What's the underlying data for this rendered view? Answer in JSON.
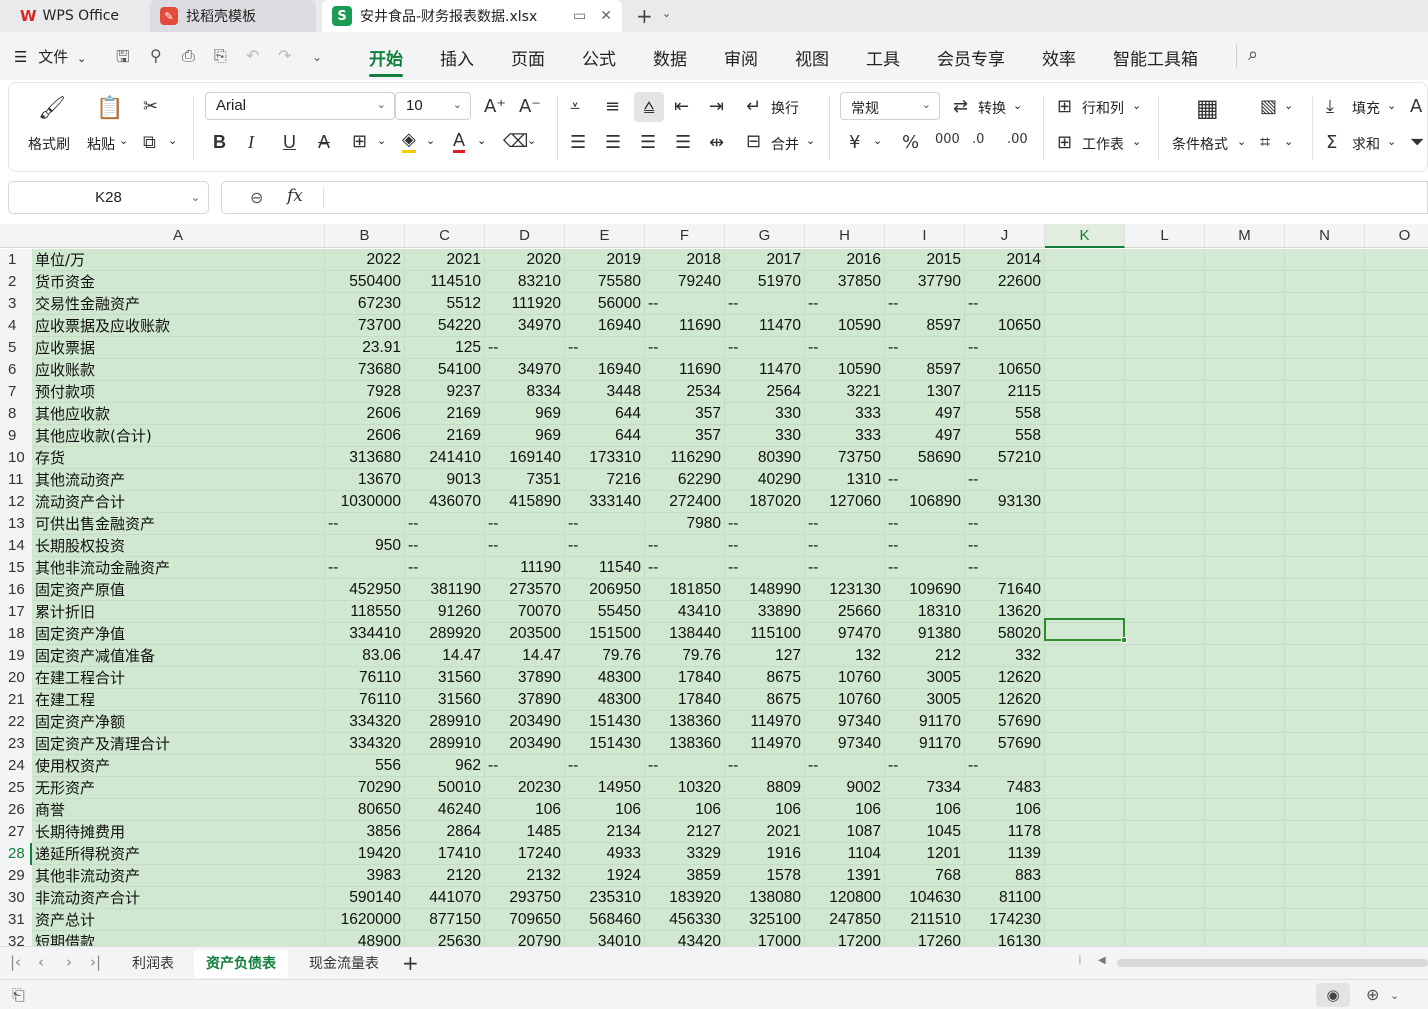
{
  "tabs": {
    "wps": "WPS Office",
    "template": "找稻壳模板",
    "file": "安井食品-财务报表数据.xlsx"
  },
  "menu": {
    "file": "文件",
    "items": [
      "开始",
      "插入",
      "页面",
      "公式",
      "数据",
      "审阅",
      "视图",
      "工具",
      "会员专享",
      "效率",
      "智能工具箱"
    ]
  },
  "ribbon": {
    "format_painter": "格式刷",
    "paste": "粘贴",
    "font": "Arial",
    "font_size": "10",
    "wrap": "换行",
    "merge": "合并",
    "number_format": "常规",
    "convert": "转换",
    "row_col": "行和列",
    "worksheet": "工作表",
    "cond_format": "条件格式",
    "fill": "填充",
    "sum": "求和"
  },
  "formula_bar": {
    "name_box": "K28",
    "fx": "fx",
    "value": ""
  },
  "columns": [
    "A",
    "B",
    "C",
    "D",
    "E",
    "F",
    "G",
    "H",
    "I",
    "J",
    "K",
    "L",
    "M",
    "N",
    "O"
  ],
  "selected_cell": "K28",
  "rows": [
    {
      "n": "1",
      "a": "单位/万",
      "v": [
        "2022",
        "2021",
        "2020",
        "2019",
        "2018",
        "2017",
        "2016",
        "2015",
        "2014"
      ]
    },
    {
      "n": "2",
      "a": "货币资金",
      "v": [
        "550400",
        "114510",
        "83210",
        "75580",
        "79240",
        "51970",
        "37850",
        "37790",
        "22600"
      ]
    },
    {
      "n": "3",
      "a": "交易性金融资产",
      "v": [
        "67230",
        "5512",
        "111920",
        "56000",
        "--",
        "--",
        "--",
        "--",
        "--"
      ]
    },
    {
      "n": "4",
      "a": "应收票据及应收账款",
      "v": [
        "73700",
        "54220",
        "34970",
        "16940",
        "11690",
        "11470",
        "10590",
        "8597",
        "10650"
      ]
    },
    {
      "n": "5",
      "a": "应收票据",
      "v": [
        "23.91",
        "125",
        "--",
        "--",
        "--",
        "--",
        "--",
        "--",
        "--"
      ]
    },
    {
      "n": "6",
      "a": "应收账款",
      "v": [
        "73680",
        "54100",
        "34970",
        "16940",
        "11690",
        "11470",
        "10590",
        "8597",
        "10650"
      ]
    },
    {
      "n": "7",
      "a": "预付款项",
      "v": [
        "7928",
        "9237",
        "8334",
        "3448",
        "2534",
        "2564",
        "3221",
        "1307",
        "2115"
      ]
    },
    {
      "n": "8",
      "a": "其他应收款",
      "v": [
        "2606",
        "2169",
        "969",
        "644",
        "357",
        "330",
        "333",
        "497",
        "558"
      ]
    },
    {
      "n": "9",
      "a": "其他应收款(合计)",
      "v": [
        "2606",
        "2169",
        "969",
        "644",
        "357",
        "330",
        "333",
        "497",
        "558"
      ]
    },
    {
      "n": "10",
      "a": "存货",
      "v": [
        "313680",
        "241410",
        "169140",
        "173310",
        "116290",
        "80390",
        "73750",
        "58690",
        "57210"
      ]
    },
    {
      "n": "11",
      "a": "其他流动资产",
      "v": [
        "13670",
        "9013",
        "7351",
        "7216",
        "62290",
        "40290",
        "1310",
        "--",
        "--"
      ]
    },
    {
      "n": "12",
      "a": "流动资产合计",
      "v": [
        "1030000",
        "436070",
        "415890",
        "333140",
        "272400",
        "187020",
        "127060",
        "106890",
        "93130"
      ]
    },
    {
      "n": "13",
      "a": "可供出售金融资产",
      "v": [
        "--",
        "--",
        "--",
        "--",
        "7980",
        "--",
        "--",
        "--",
        "--"
      ]
    },
    {
      "n": "14",
      "a": "长期股权投资",
      "v": [
        "950",
        "--",
        "--",
        "--",
        "--",
        "--",
        "--",
        "--",
        "--"
      ]
    },
    {
      "n": "15",
      "a": "其他非流动金融资产",
      "v": [
        "--",
        "--",
        "11190",
        "11540",
        "--",
        "--",
        "--",
        "--",
        "--"
      ]
    },
    {
      "n": "16",
      "a": "固定资产原值",
      "v": [
        "452950",
        "381190",
        "273570",
        "206950",
        "181850",
        "148990",
        "123130",
        "109690",
        "71640"
      ]
    },
    {
      "n": "17",
      "a": "累计折旧",
      "v": [
        "118550",
        "91260",
        "70070",
        "55450",
        "43410",
        "33890",
        "25660",
        "18310",
        "13620"
      ]
    },
    {
      "n": "18",
      "a": "固定资产净值",
      "v": [
        "334410",
        "289920",
        "203500",
        "151500",
        "138440",
        "115100",
        "97470",
        "91380",
        "58020"
      ]
    },
    {
      "n": "19",
      "a": "固定资产减值准备",
      "v": [
        "83.06",
        "14.47",
        "14.47",
        "79.76",
        "79.76",
        "127",
        "132",
        "212",
        "332"
      ]
    },
    {
      "n": "20",
      "a": "在建工程合计",
      "v": [
        "76110",
        "31560",
        "37890",
        "48300",
        "17840",
        "8675",
        "10760",
        "3005",
        "12620"
      ]
    },
    {
      "n": "21",
      "a": "在建工程",
      "v": [
        "76110",
        "31560",
        "37890",
        "48300",
        "17840",
        "8675",
        "10760",
        "3005",
        "12620"
      ]
    },
    {
      "n": "22",
      "a": "固定资产净额",
      "v": [
        "334320",
        "289910",
        "203490",
        "151430",
        "138360",
        "114970",
        "97340",
        "91170",
        "57690"
      ]
    },
    {
      "n": "23",
      "a": "固定资产及清理合计",
      "v": [
        "334320",
        "289910",
        "203490",
        "151430",
        "138360",
        "114970",
        "97340",
        "91170",
        "57690"
      ]
    },
    {
      "n": "24",
      "a": "使用权资产",
      "v": [
        "556",
        "962",
        "--",
        "--",
        "--",
        "--",
        "--",
        "--",
        "--"
      ]
    },
    {
      "n": "25",
      "a": "无形资产",
      "v": [
        "70290",
        "50010",
        "20230",
        "14950",
        "10320",
        "8809",
        "9002",
        "7334",
        "7483"
      ]
    },
    {
      "n": "26",
      "a": "商誉",
      "v": [
        "80650",
        "46240",
        "106",
        "106",
        "106",
        "106",
        "106",
        "106",
        "106"
      ]
    },
    {
      "n": "27",
      "a": "长期待摊费用",
      "v": [
        "3856",
        "2864",
        "1485",
        "2134",
        "2127",
        "2021",
        "1087",
        "1045",
        "1178"
      ]
    },
    {
      "n": "28",
      "a": "递延所得税资产",
      "v": [
        "19420",
        "17410",
        "17240",
        "4933",
        "3329",
        "1916",
        "1104",
        "1201",
        "1139"
      ]
    },
    {
      "n": "29",
      "a": "其他非流动资产",
      "v": [
        "3983",
        "2120",
        "2132",
        "1924",
        "3859",
        "1578",
        "1391",
        "768",
        "883"
      ]
    },
    {
      "n": "30",
      "a": "非流动资产合计",
      "v": [
        "590140",
        "441070",
        "293750",
        "235310",
        "183920",
        "138080",
        "120800",
        "104630",
        "81100"
      ]
    },
    {
      "n": "31",
      "a": "资产总计",
      "v": [
        "1620000",
        "877150",
        "709650",
        "568460",
        "456330",
        "325100",
        "247850",
        "211510",
        "174230"
      ]
    },
    {
      "n": "32",
      "a": "短期借款",
      "v": [
        "48900",
        "25630",
        "20790",
        "34010",
        "43420",
        "17000",
        "17200",
        "17260",
        "16130"
      ]
    }
  ],
  "sheets": [
    "利润表",
    "资产负债表",
    "现金流量表"
  ],
  "active_sheet": "资产负债表"
}
